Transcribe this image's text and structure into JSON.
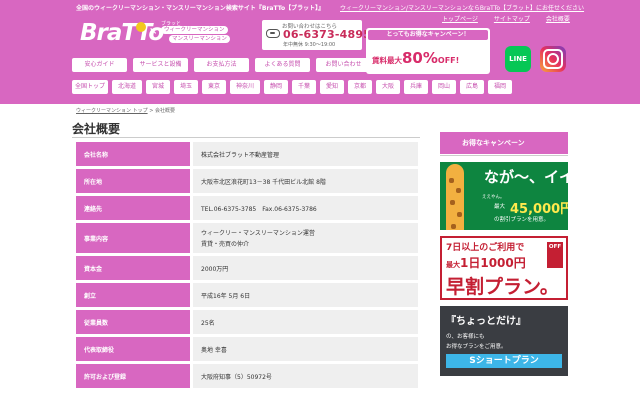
{
  "header": {
    "tagline": "全国のウィークリーマンション・マンスリーマンション検索サイト『BraTTo【ブラット】』",
    "note": "ウィークリーマンション/マンスリーマンションならBraTTo【ブラット】にお任せください",
    "links": [
      "トップページ",
      "サイトマップ",
      "会社概要"
    ],
    "logo_text": "BraTTo",
    "logo_x": "×",
    "logo_sub_small": "ブラッと",
    "logo_sub_weekly": "ウィークリーマンション",
    "logo_sub_monthly": "マンスリーマンション",
    "phone_label": "お問い合わせはこちら",
    "phone_number": "06-6373-4895",
    "phone_hours": "年中無休 9:30〜19:00",
    "campaign_head": "とってもお得なキャンペーン！",
    "campaign_prefix": "賃料最大",
    "campaign_percent": "80%",
    "campaign_suffix": "OFF!",
    "line_label": "LINE"
  },
  "main_nav": [
    "安心ガイド",
    "サービスと設備",
    "お支払方法",
    "よくある質問",
    "お問い合わせ"
  ],
  "area_nav": [
    "全国トップ",
    "北海道",
    "宮城",
    "埼玉",
    "東京",
    "神奈川",
    "静岡",
    "千葉",
    "愛知",
    "京都",
    "大阪",
    "兵庫",
    "岡山",
    "広島",
    "福岡"
  ],
  "breadcrumb": {
    "link": "ウィークリーマンション トップ",
    "separator": ">",
    "current": "会社概要"
  },
  "page_title": "会社概要",
  "company_info": [
    {
      "label": "会社名称",
      "value": "株式会社ブラット不動産管理"
    },
    {
      "label": "所在地",
      "value": "大阪市北区浪花町13－38 千代田ビル北館 8階"
    },
    {
      "label": "連絡先",
      "value": "TEL.06-6375-3785　Fax.06-6375-3786"
    },
    {
      "label": "事業内容",
      "value": "ウィークリー・マンスリーマンション運営",
      "value2": "賃貸・売買の仲介"
    },
    {
      "label": "資本金",
      "value": "2000万円"
    },
    {
      "label": "創立",
      "value": "平成16年 5月 6日"
    },
    {
      "label": "従業員数",
      "value": "25名"
    },
    {
      "label": "代表取締役",
      "value": "奥地 幸喜"
    },
    {
      "label": "許可および登録",
      "value": "大阪府知事（5）50972号"
    }
  ],
  "sidebar": {
    "heading": "お得なキャンペーン",
    "banner1": {
      "headline": "なが〜、イイ。",
      "small_left": "ええやん。",
      "prefix": "最大",
      "amount": "45,000円",
      "suffix": "の割引プランを用意。"
    },
    "banner2": {
      "line1": "7日以上のご利用で",
      "line2_prefix": "最大",
      "line2_amount": "1日1000円",
      "off": "OFF",
      "line3": "早割プラン。"
    },
    "banner3": {
      "line1": "『ちょっとだけ』",
      "line2": "の、お客様にも",
      "line3": "お得なプランをご用意。",
      "bar": "Sショートプラン"
    }
  },
  "colors": {
    "brand_pink": "#d867c1",
    "accent_red": "#c41f33",
    "phone_red": "#c92c5a",
    "row_value_bg": "#efefef",
    "line_green": "#06c755",
    "banner_green": "#0e8540",
    "banner_dark": "#3a3d42",
    "banner_blue": "#3db6e8"
  },
  "icons": [
    "phone-icon",
    "line-icon",
    "instagram-icon",
    "logo-badge-icon",
    "giraffe-illustration"
  ]
}
